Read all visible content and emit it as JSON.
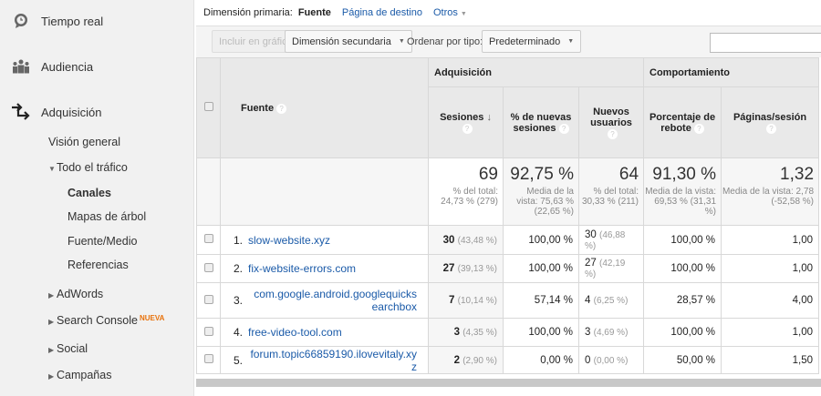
{
  "sidebar": {
    "top": [
      {
        "label": "Tiempo real",
        "icon": "clock-icon"
      },
      {
        "label": "Audiencia",
        "icon": "people-icon"
      },
      {
        "label": "Adquisición",
        "icon": "acquisition-arrows-icon"
      }
    ],
    "vision": "Visión general",
    "todo": "Todo el tráfico",
    "canales": "Canales",
    "mapas": "Mapas de árbol",
    "fuente_medio": "Fuente/Medio",
    "referencias": "Referencias",
    "adwords": "AdWords",
    "search_console": "Search Console",
    "nueva": "NUEVA",
    "social": "Social",
    "campanas": "Campañas"
  },
  "dimension": {
    "label": "Dimensión primaria:",
    "active": "Fuente",
    "landing": "Página de destino",
    "otros": "Otros"
  },
  "toolbar": {
    "incluir": "Incluir en gráfico",
    "secundaria": "Dimensión secundaria",
    "ordenar": "Ordenar por tipo:",
    "predeterminado": "Predeterminado",
    "search_value": ""
  },
  "table": {
    "groups": {
      "adq": "Adquisición",
      "comp": "Comportamiento"
    },
    "headers": {
      "fuente": "Fuente",
      "sesiones": "Sesiones",
      "nuevas": "% de nuevas sesiones",
      "nuevos": "Nuevos usuarios",
      "rebote": "Porcentaje de rebote",
      "paginas": "Páginas/sesión"
    },
    "totals": {
      "sesiones": "69",
      "sesiones_sub": "% del total: 24,73 % (279)",
      "nuevas": "92,75 %",
      "nuevas_sub": "Media de la vista: 75,63 % (22,65 %)",
      "nuevos": "64",
      "nuevos_sub": "% del total: 30,33 % (211)",
      "rebote": "91,30 %",
      "rebote_sub": "Media de la vista: 69,53 % (31,31 %)",
      "paginas": "1,32",
      "paginas_sub": "Media de la vista: 2,78 (-52,58 %)"
    },
    "rows": [
      {
        "n": "1.",
        "src": "slow-website.xyz",
        "ses": "30",
        "ses_pct": "(43,48 %)",
        "nuevas": "100,00 %",
        "nu": "30",
        "nu_pct": "(46,88 %)",
        "reb": "100,00 %",
        "pag": "1,00"
      },
      {
        "n": "2.",
        "src": "fix-website-errors.com",
        "ses": "27",
        "ses_pct": "(39,13 %)",
        "nuevas": "100,00 %",
        "nu": "27",
        "nu_pct": "(42,19 %)",
        "reb": "100,00 %",
        "pag": "1,00"
      },
      {
        "n": "3.",
        "src": "com.google.android.googlequicksearchbox",
        "ses": "7",
        "ses_pct": "(10,14 %)",
        "nuevas": "57,14 %",
        "nu": "4",
        "nu_pct": "(6,25 %)",
        "reb": "28,57 %",
        "pag": "4,00"
      },
      {
        "n": "4.",
        "src": "free-video-tool.com",
        "ses": "3",
        "ses_pct": "(4,35 %)",
        "nuevas": "100,00 %",
        "nu": "3",
        "nu_pct": "(4,69 %)",
        "reb": "100,00 %",
        "pag": "1,00"
      },
      {
        "n": "5.",
        "src": "forum.topic66859190.ilovevitaly.xyz",
        "ses": "2",
        "ses_pct": "(2,90 %)",
        "nuevas": "0,00 %",
        "nu": "0",
        "nu_pct": "(0,00 %)",
        "reb": "50,00 %",
        "pag": "1,50"
      }
    ]
  }
}
